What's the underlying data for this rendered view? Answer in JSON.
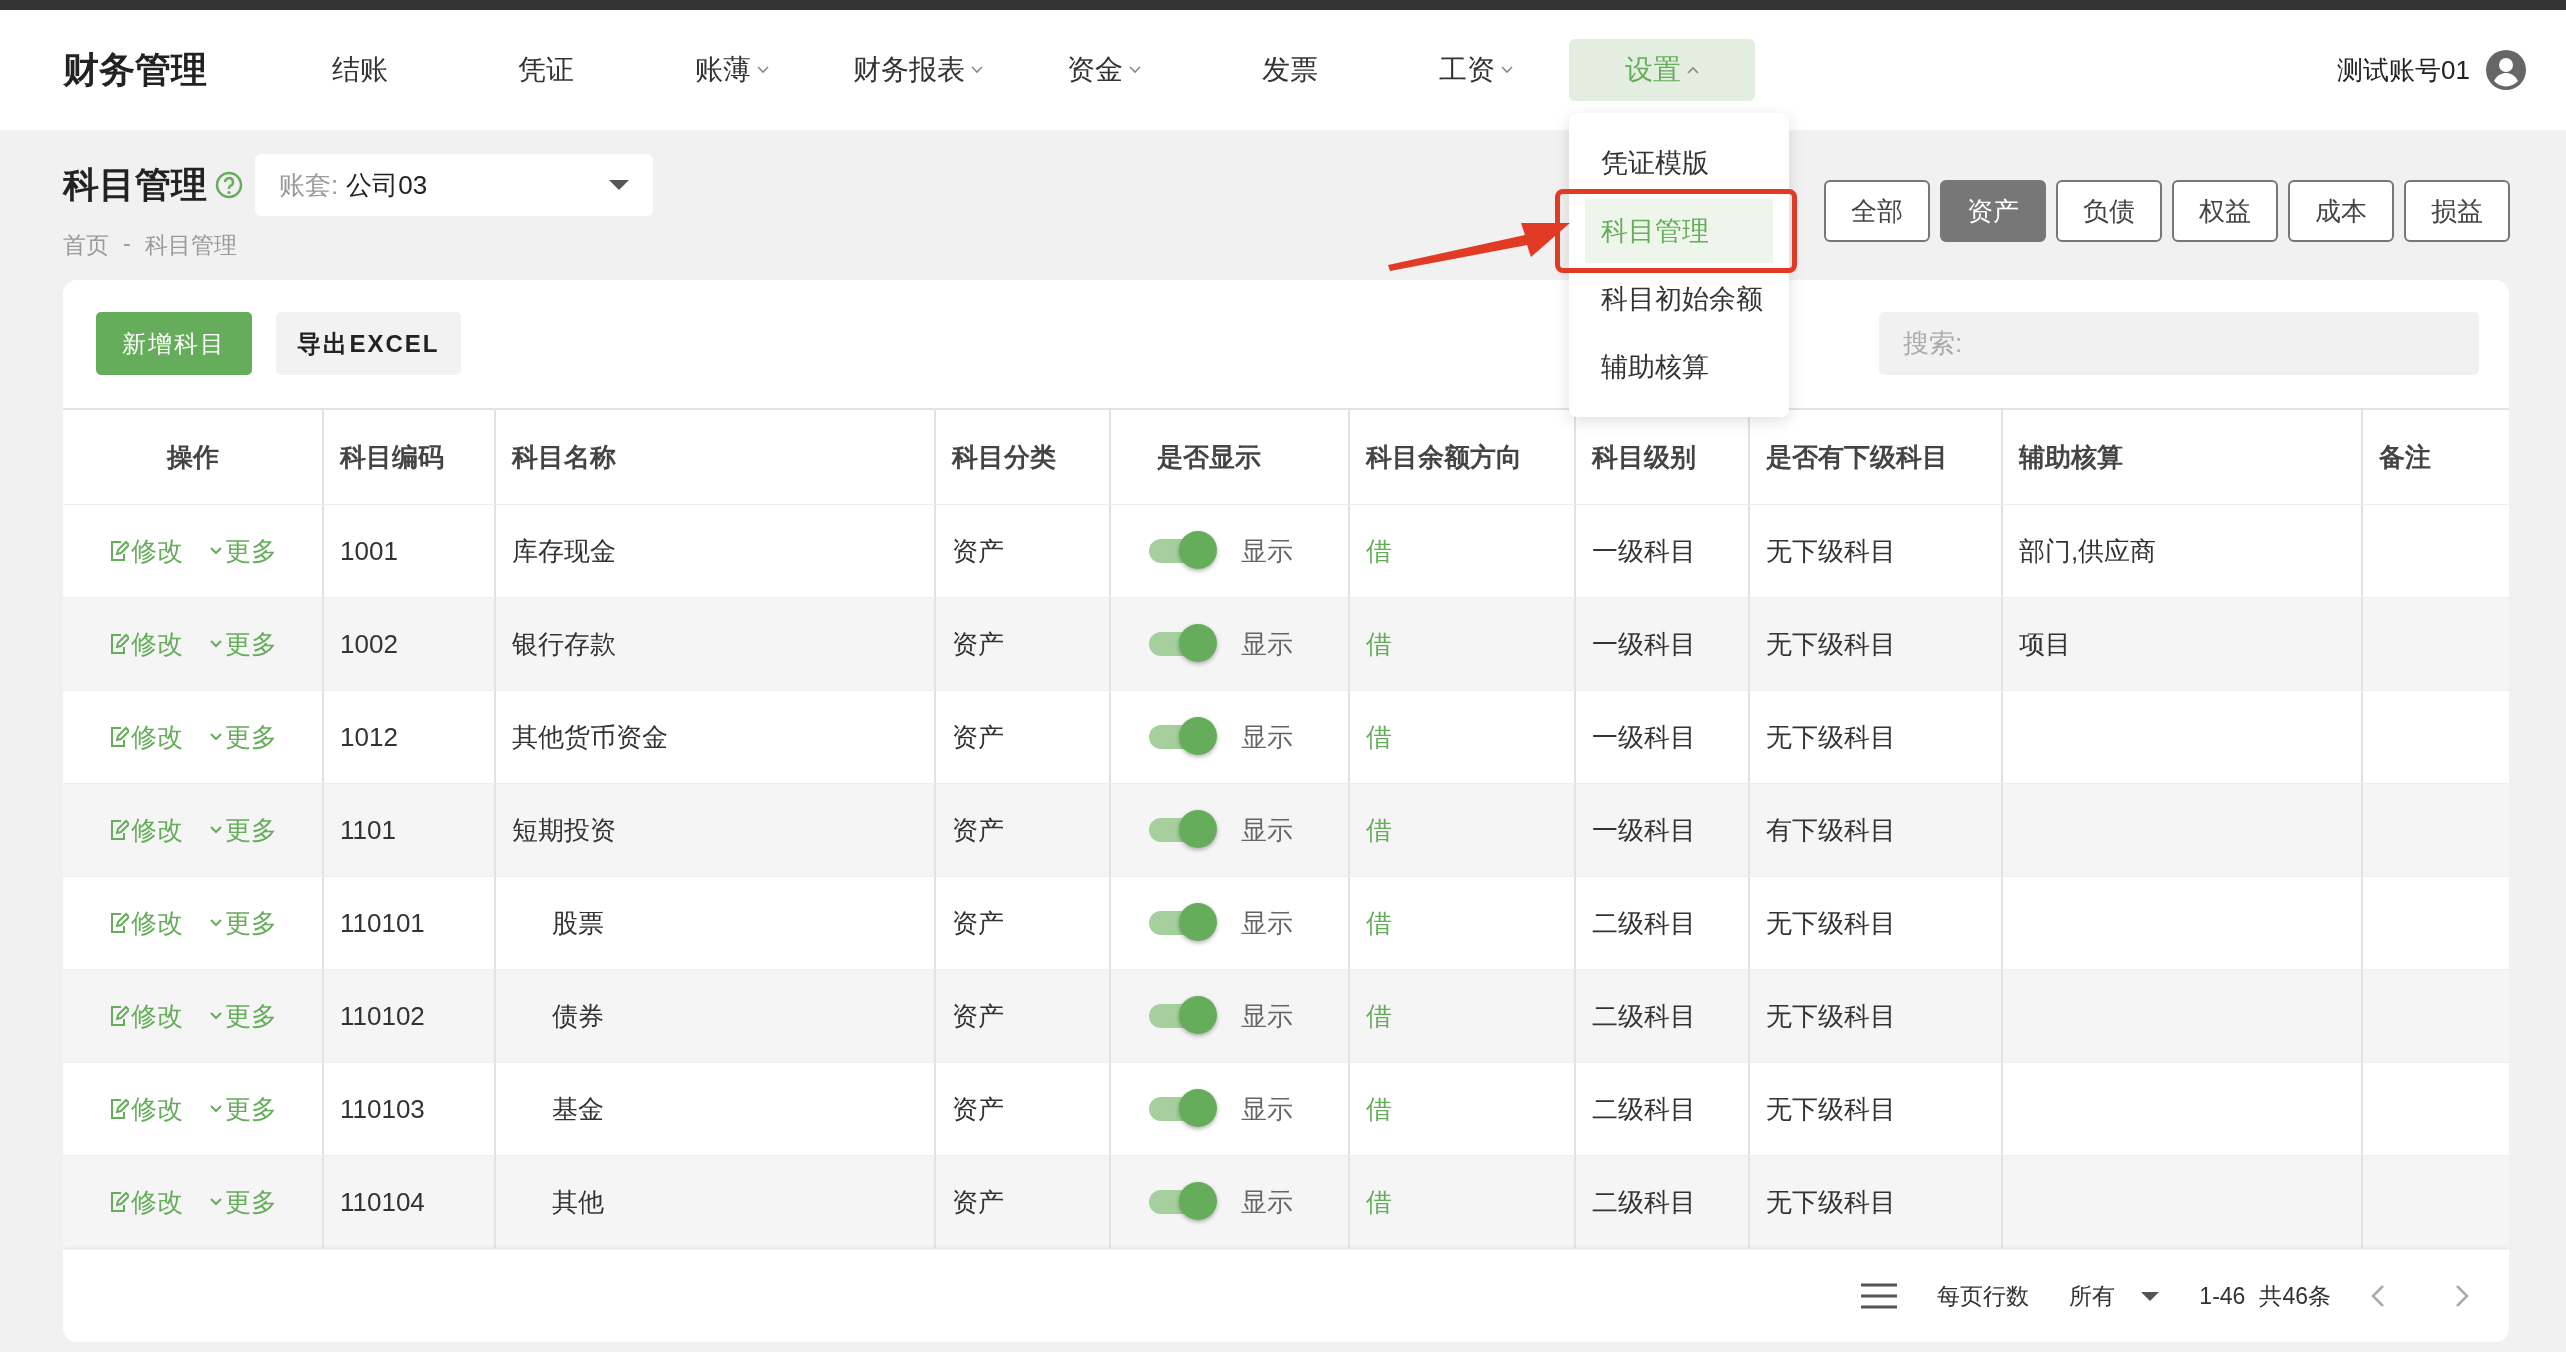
{
  "header": {
    "brand": "财务管理",
    "user": "测试账号01",
    "nav": [
      {
        "label": "结账",
        "dropdown": false,
        "selected": false
      },
      {
        "label": "凭证",
        "dropdown": false,
        "selected": false
      },
      {
        "label": "账薄",
        "dropdown": true,
        "expanded": false,
        "selected": false
      },
      {
        "label": "财务报表",
        "dropdown": true,
        "expanded": false,
        "selected": false
      },
      {
        "label": "资金",
        "dropdown": true,
        "expanded": false,
        "selected": false
      },
      {
        "label": "发票",
        "dropdown": false,
        "selected": false
      },
      {
        "label": "工资",
        "dropdown": true,
        "expanded": false,
        "selected": false
      },
      {
        "label": "设置",
        "dropdown": true,
        "expanded": true,
        "selected": true
      }
    ]
  },
  "settings_menu": {
    "items": [
      {
        "label": "凭证模版",
        "selected": false,
        "callout": false
      },
      {
        "label": "科目管理",
        "selected": true,
        "callout": true
      },
      {
        "label": "科目初始余额",
        "selected": false,
        "callout": false
      },
      {
        "label": "辅助核算",
        "selected": false,
        "callout": false
      }
    ]
  },
  "page": {
    "title": "科目管理",
    "ledger_select": {
      "label": "账套:",
      "value": "公司03"
    },
    "breadcrumb": {
      "separator": "-",
      "items": [
        "首页",
        "科目管理"
      ]
    }
  },
  "filters": [
    {
      "label": "全部",
      "selected": false
    },
    {
      "label": "资产",
      "selected": true
    },
    {
      "label": "负债",
      "selected": false
    },
    {
      "label": "权益",
      "selected": false
    },
    {
      "label": "成本",
      "selected": false
    },
    {
      "label": "损益",
      "selected": false
    }
  ],
  "toolbar": {
    "add_button": "新增科目",
    "export_button": "导出EXCEL",
    "search": {
      "placeholder": "搜索:"
    }
  },
  "table": {
    "columns": [
      "操作",
      "科目编码",
      "科目名称",
      "科目分类",
      "是否显示",
      "科目余额方向",
      "科目级别",
      "是否有下级科目",
      "辅助核算",
      "备注"
    ],
    "rows": [
      {
        "edit": "修改",
        "more": "更多",
        "code": "1001",
        "name": "库存现金",
        "category": "资产",
        "shown": true,
        "show_label": "显示",
        "direction": "借",
        "level_name": "一级科目",
        "sub": "无下级科目",
        "auxiliary": "部门,供应商"
      },
      {
        "edit": "修改",
        "more": "更多",
        "code": "1002",
        "name": "银行存款",
        "category": "资产",
        "shown": true,
        "show_label": "显示",
        "direction": "借",
        "level_name": "一级科目",
        "sub": "无下级科目",
        "auxiliary": "项目"
      },
      {
        "edit": "修改",
        "more": "更多",
        "code": "1012",
        "name": "其他货币资金",
        "category": "资产",
        "shown": true,
        "show_label": "显示",
        "direction": "借",
        "level_name": "一级科目",
        "sub": "无下级科目"
      },
      {
        "edit": "修改",
        "more": "更多",
        "code": "1101",
        "name": "短期投资",
        "category": "资产",
        "shown": true,
        "show_label": "显示",
        "direction": "借",
        "level_name": "一级科目",
        "sub": "有下级科目",
        "children": [
          {
            "edit": "修改",
            "more": "更多",
            "code": "110101",
            "name": "股票",
            "category": "资产",
            "shown": true,
            "show_label": "显示",
            "direction": "借",
            "level_name": "二级科目",
            "sub": "无下级科目"
          },
          {
            "edit": "修改",
            "more": "更多",
            "code": "110102",
            "name": "债券",
            "category": "资产",
            "shown": true,
            "show_label": "显示",
            "direction": "借",
            "level_name": "二级科目",
            "sub": "无下级科目"
          },
          {
            "edit": "修改",
            "more": "更多",
            "code": "110103",
            "name": "基金",
            "category": "资产",
            "shown": true,
            "show_label": "显示",
            "direction": "借",
            "level_name": "二级科目",
            "sub": "无下级科目"
          },
          {
            "edit": "修改",
            "more": "更多",
            "code": "110104",
            "name": "其他",
            "category": "资产",
            "shown": true,
            "show_label": "显示",
            "direction": "借",
            "level_name": "二级科目",
            "sub": "无下级科目"
          }
        ]
      }
    ]
  },
  "footer": {
    "rows_per_page_label": "每页行数",
    "rows_per_page": "所有",
    "range": "1-46",
    "total": "共46条"
  }
}
